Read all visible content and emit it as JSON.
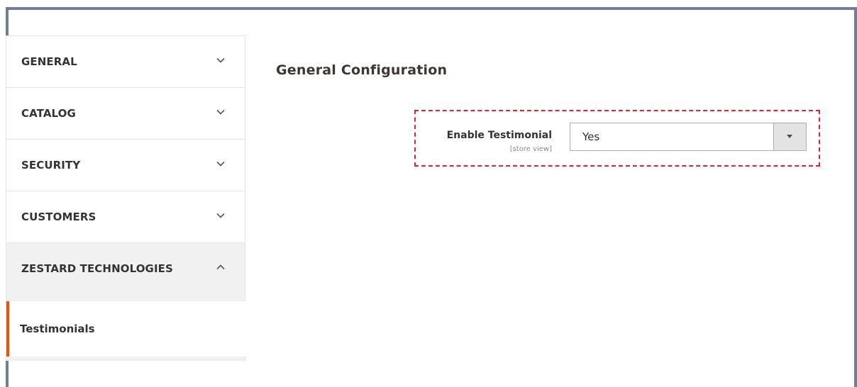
{
  "sidebar": {
    "items": [
      {
        "label": "GENERAL",
        "expanded": false
      },
      {
        "label": "CATALOG",
        "expanded": false
      },
      {
        "label": "SECURITY",
        "expanded": false
      },
      {
        "label": "CUSTOMERS",
        "expanded": false
      },
      {
        "label": "ZESTARD TECHNOLOGIES",
        "expanded": true
      }
    ],
    "subitems": [
      {
        "label": "Testimonials",
        "active": true
      }
    ]
  },
  "main": {
    "section_title": "General Configuration",
    "fields": [
      {
        "label": "Enable Testimonial",
        "scope": "[store view]",
        "value": "Yes"
      }
    ]
  },
  "icons": {
    "collapsed": "chevron-down-icon",
    "expanded": "chevron-up-icon",
    "select": "triangle-down-icon"
  },
  "colors": {
    "active_accent": "#eb5202",
    "highlight_dash": "#e0242f",
    "frame_border": "#6b7f95"
  }
}
